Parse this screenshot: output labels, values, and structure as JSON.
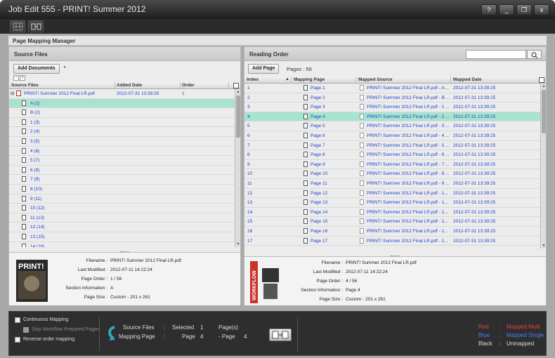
{
  "window": {
    "title": "Job Edit 555 - PRINT! Summer 2012",
    "buttons": [
      "?",
      "_",
      "❐",
      "x"
    ]
  },
  "manager_title": "Page Mapping Manager",
  "source_panel": {
    "title": "Source Files",
    "add_button": "Add Documents",
    "add_dropdown": "•",
    "expand_minus": "−",
    "expand_plus": "+",
    "columns": [
      "Source Files",
      "Added Date",
      "Order"
    ],
    "file_row": {
      "name": "PRINT! Summer 2012 Final LR.pdf",
      "date": "2012-07-31 13:39:25",
      "order": "1"
    },
    "pages": [
      "A (1)",
      "B (2)",
      "1 (3)",
      "2 (4)",
      "3 (5)",
      "4 (6)",
      "5 (7)",
      "6 (8)",
      "7 (9)",
      "8 (10)",
      "9 (11)",
      "10 (12)",
      "11 (13)",
      "12 (14)",
      "13 (15)",
      "14 (16)"
    ],
    "selected_index": 0,
    "details": {
      "labels": [
        "Filename :",
        "Last Modified :",
        "Page Order :",
        "Section Information :",
        "Page Size :"
      ],
      "values": [
        "PRINT! Summer 2012 Final LR.pdf",
        "2012-07-11 14:22:24",
        "1 / 56",
        "A",
        "Custom - 201 x 261"
      ],
      "thumbnail_text": "PRINT!"
    }
  },
  "reading_panel": {
    "title": "Reading Order",
    "search": {
      "placeholder": "",
      "value": ""
    },
    "add_button": "Add Page",
    "pages_count": "Pages : 56",
    "columns": [
      "Index",
      "Mapping Page",
      "Mapped Source",
      "Mapped Date"
    ],
    "rows": [
      {
        "index": "1",
        "page": "Page 1",
        "source": "PRINT! Summer 2012 Final LR.pdf - A ...",
        "date": "2012-07-31 13:39:25"
      },
      {
        "index": "2",
        "page": "Page 2",
        "source": "PRINT! Summer 2012 Final LR.pdf - B ...",
        "date": "2012-07-31 13:39:25"
      },
      {
        "index": "3",
        "page": "Page 3",
        "source": "PRINT! Summer 2012 Final LR.pdf - 1 ...",
        "date": "2012-07-31 13:39:25"
      },
      {
        "index": "4",
        "page": "Page 4",
        "source": "PRINT! Summer 2012 Final LR.pdf - 2 ...",
        "date": "2012-07-31 13:39:25"
      },
      {
        "index": "5",
        "page": "Page 5",
        "source": "PRINT! Summer 2012 Final LR.pdf - 3 ...",
        "date": "2012-07-31 13:39:25"
      },
      {
        "index": "6",
        "page": "Page 6",
        "source": "PRINT! Summer 2012 Final LR.pdf - 4 ...",
        "date": "2012-07-31 13:39:25"
      },
      {
        "index": "7",
        "page": "Page 7",
        "source": "PRINT! Summer 2012 Final LR.pdf - 5 ...",
        "date": "2012-07-31 13:39:25"
      },
      {
        "index": "8",
        "page": "Page 8",
        "source": "PRINT! Summer 2012 Final LR.pdf - 6 ...",
        "date": "2012-07-31 13:39:25"
      },
      {
        "index": "9",
        "page": "Page 9",
        "source": "PRINT! Summer 2012 Final LR.pdf - 7 ...",
        "date": "2012-07-31 13:39:25"
      },
      {
        "index": "10",
        "page": "Page 10",
        "source": "PRINT! Summer 2012 Final LR.pdf - 8 ...",
        "date": "2012-07-31 13:39:25"
      },
      {
        "index": "11",
        "page": "Page 11",
        "source": "PRINT! Summer 2012 Final LR.pdf - 9 ...",
        "date": "2012-07-31 13:39:25"
      },
      {
        "index": "12",
        "page": "Page 12",
        "source": "PRINT! Summer 2012 Final LR.pdf - 1...",
        "date": "2012-07-31 13:39:25"
      },
      {
        "index": "13",
        "page": "Page 13",
        "source": "PRINT! Summer 2012 Final LR.pdf - 1...",
        "date": "2012-07-31 13:39:25"
      },
      {
        "index": "14",
        "page": "Page 14",
        "source": "PRINT! Summer 2012 Final LR.pdf - 1...",
        "date": "2012-07-31 13:39:25"
      },
      {
        "index": "15",
        "page": "Page 15",
        "source": "PRINT! Summer 2012 Final LR.pdf - 1...",
        "date": "2012-07-31 13:39:25"
      },
      {
        "index": "16",
        "page": "Page 16",
        "source": "PRINT! Summer 2012 Final LR.pdf - 1...",
        "date": "2012-07-31 13:39:25"
      },
      {
        "index": "17",
        "page": "Page 17",
        "source": "PRINT! Summer 2012 Final LR.pdf - 1...",
        "date": "2012-07-31 13:39:25"
      }
    ],
    "selected_index": 3,
    "details": {
      "labels": [
        "Filename :",
        "Last Modified :",
        "Page Order :",
        "Section Information :",
        "Page Size :"
      ],
      "values": [
        "PRINT! Summer 2012 Final LR.pdf",
        "2012-07-11 14:22:24",
        "4 / 56",
        "Page 4",
        "Custom - 201 x 261"
      ],
      "thumbnail_text": "WORKFLOW"
    }
  },
  "bottom": {
    "options": [
      {
        "label": "Continuous Mapping",
        "enabled": true
      },
      {
        "label": "Skip Workflow Prepared Pages",
        "enabled": false
      },
      {
        "label": "Reverse order mapping",
        "enabled": true
      }
    ],
    "status": {
      "line1": [
        "Source Files",
        ":",
        "Selected",
        "1",
        "Page(s)"
      ],
      "line2": [
        "Mapping Page",
        ":",
        "Page",
        "4",
        "- Page",
        "4"
      ]
    },
    "legend": [
      {
        "color_name": "Red",
        "meaning": "Mapped Multi",
        "hex": "#e84040"
      },
      {
        "color_name": "Blue",
        "meaning": "Mapped Single",
        "hex": "#4a7cff"
      },
      {
        "color_name": "Black",
        "meaning": "Unmapped",
        "hex": "#dddddd"
      }
    ],
    "legend_sep": ":"
  },
  "colors": {
    "selection": "#a7e3cf",
    "link_blue": "#1f3fcf"
  }
}
